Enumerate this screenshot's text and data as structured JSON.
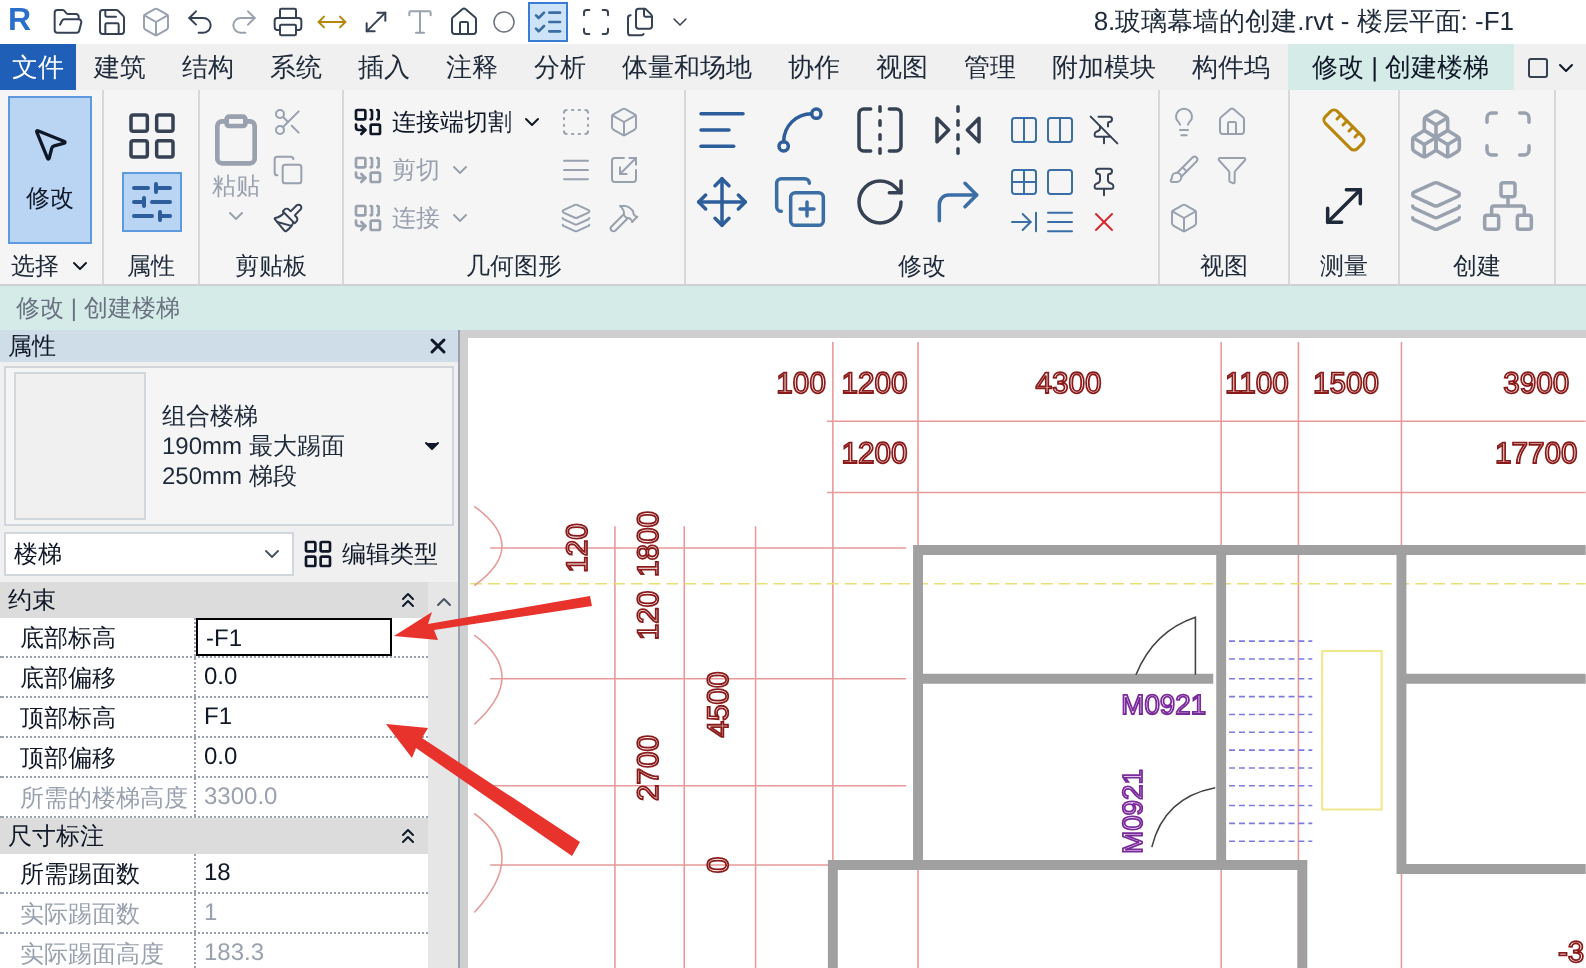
{
  "title_bar": {
    "logo": "R",
    "title": "8.玻璃幕墙的创建.rvt - 楼层平面: -F1"
  },
  "tabs": [
    {
      "label": "文件",
      "kind": "file",
      "selected": false
    },
    {
      "label": "建筑",
      "kind": "tab",
      "selected": false
    },
    {
      "label": "结构",
      "kind": "tab",
      "selected": false
    },
    {
      "label": "系统",
      "kind": "tab",
      "selected": false
    },
    {
      "label": "插入",
      "kind": "tab",
      "selected": false
    },
    {
      "label": "注释",
      "kind": "tab",
      "selected": false
    },
    {
      "label": "分析",
      "kind": "tab",
      "selected": false
    },
    {
      "label": "体量和场地",
      "kind": "tab",
      "selected": false
    },
    {
      "label": "协作",
      "kind": "tab",
      "selected": false
    },
    {
      "label": "视图",
      "kind": "tab",
      "selected": false
    },
    {
      "label": "管理",
      "kind": "tab",
      "selected": false
    },
    {
      "label": "附加模块",
      "kind": "tab",
      "selected": false
    },
    {
      "label": "构件坞",
      "kind": "tab",
      "selected": false
    },
    {
      "label": "修改 | 创建楼梯",
      "kind": "tab",
      "selected": true
    }
  ],
  "ribbon": {
    "panels": [
      {
        "label": "选择",
        "dropdown": true
      },
      {
        "label": "属性",
        "dropdown": false
      },
      {
        "label": "剪贴板",
        "dropdown": false
      },
      {
        "label": "几何图形",
        "dropdown": false
      },
      {
        "label": "修改",
        "dropdown": false
      },
      {
        "label": "视图",
        "dropdown": false
      },
      {
        "label": "测量",
        "dropdown": false
      },
      {
        "label": "创建",
        "dropdown": false
      }
    ],
    "modify_button": {
      "label": "修改",
      "selected": true
    },
    "properties_button": {
      "selected": true
    },
    "paste_button": {
      "label": "粘贴",
      "disabled": true
    },
    "geometry_items": [
      {
        "label": "连接端切割",
        "disabled": false
      },
      {
        "label": "剪切",
        "disabled": true
      },
      {
        "label": "连接",
        "disabled": true
      }
    ]
  },
  "context_bar": {
    "text": "修改 | 创建楼梯"
  },
  "properties": {
    "title": "属性",
    "type_lines": [
      "组合楼梯",
      "190mm 最大踢面",
      "250mm 梯段"
    ],
    "category": "楼梯",
    "edit_type": "编辑类型",
    "groups": [
      {
        "name": "约束",
        "expanded": true,
        "rows": [
          {
            "label": "底部标高",
            "value": "-F1",
            "disabled": false,
            "editing": true
          },
          {
            "label": "底部偏移",
            "value": "0.0",
            "disabled": false,
            "editing": false
          },
          {
            "label": "顶部标高",
            "value": "F1",
            "disabled": false,
            "editing": false
          },
          {
            "label": "顶部偏移",
            "value": "0.0",
            "disabled": false,
            "editing": false
          },
          {
            "label": "所需的楼梯高度",
            "value": "3300.0",
            "disabled": true,
            "editing": false
          }
        ]
      },
      {
        "name": "尺寸标注",
        "expanded": true,
        "rows": [
          {
            "label": "所需踢面数",
            "value": "18",
            "disabled": false,
            "editing": false
          },
          {
            "label": "实际踢面数",
            "value": "1",
            "disabled": true,
            "editing": false
          },
          {
            "label": "实际踢面高度",
            "value": "183.3",
            "disabled": true,
            "editing": false
          }
        ]
      }
    ]
  },
  "drawing": {
    "top_dimensions": [
      "100",
      "1200",
      "4300",
      "1100",
      "1500",
      "3900"
    ],
    "second_dimensions": [
      "1200",
      "17700"
    ],
    "left_dimensions": [
      "120",
      "1800",
      "120",
      "4500",
      "2700",
      "0"
    ],
    "door_tags": [
      "M0921",
      "M0921"
    ],
    "edge_label": "-3"
  }
}
